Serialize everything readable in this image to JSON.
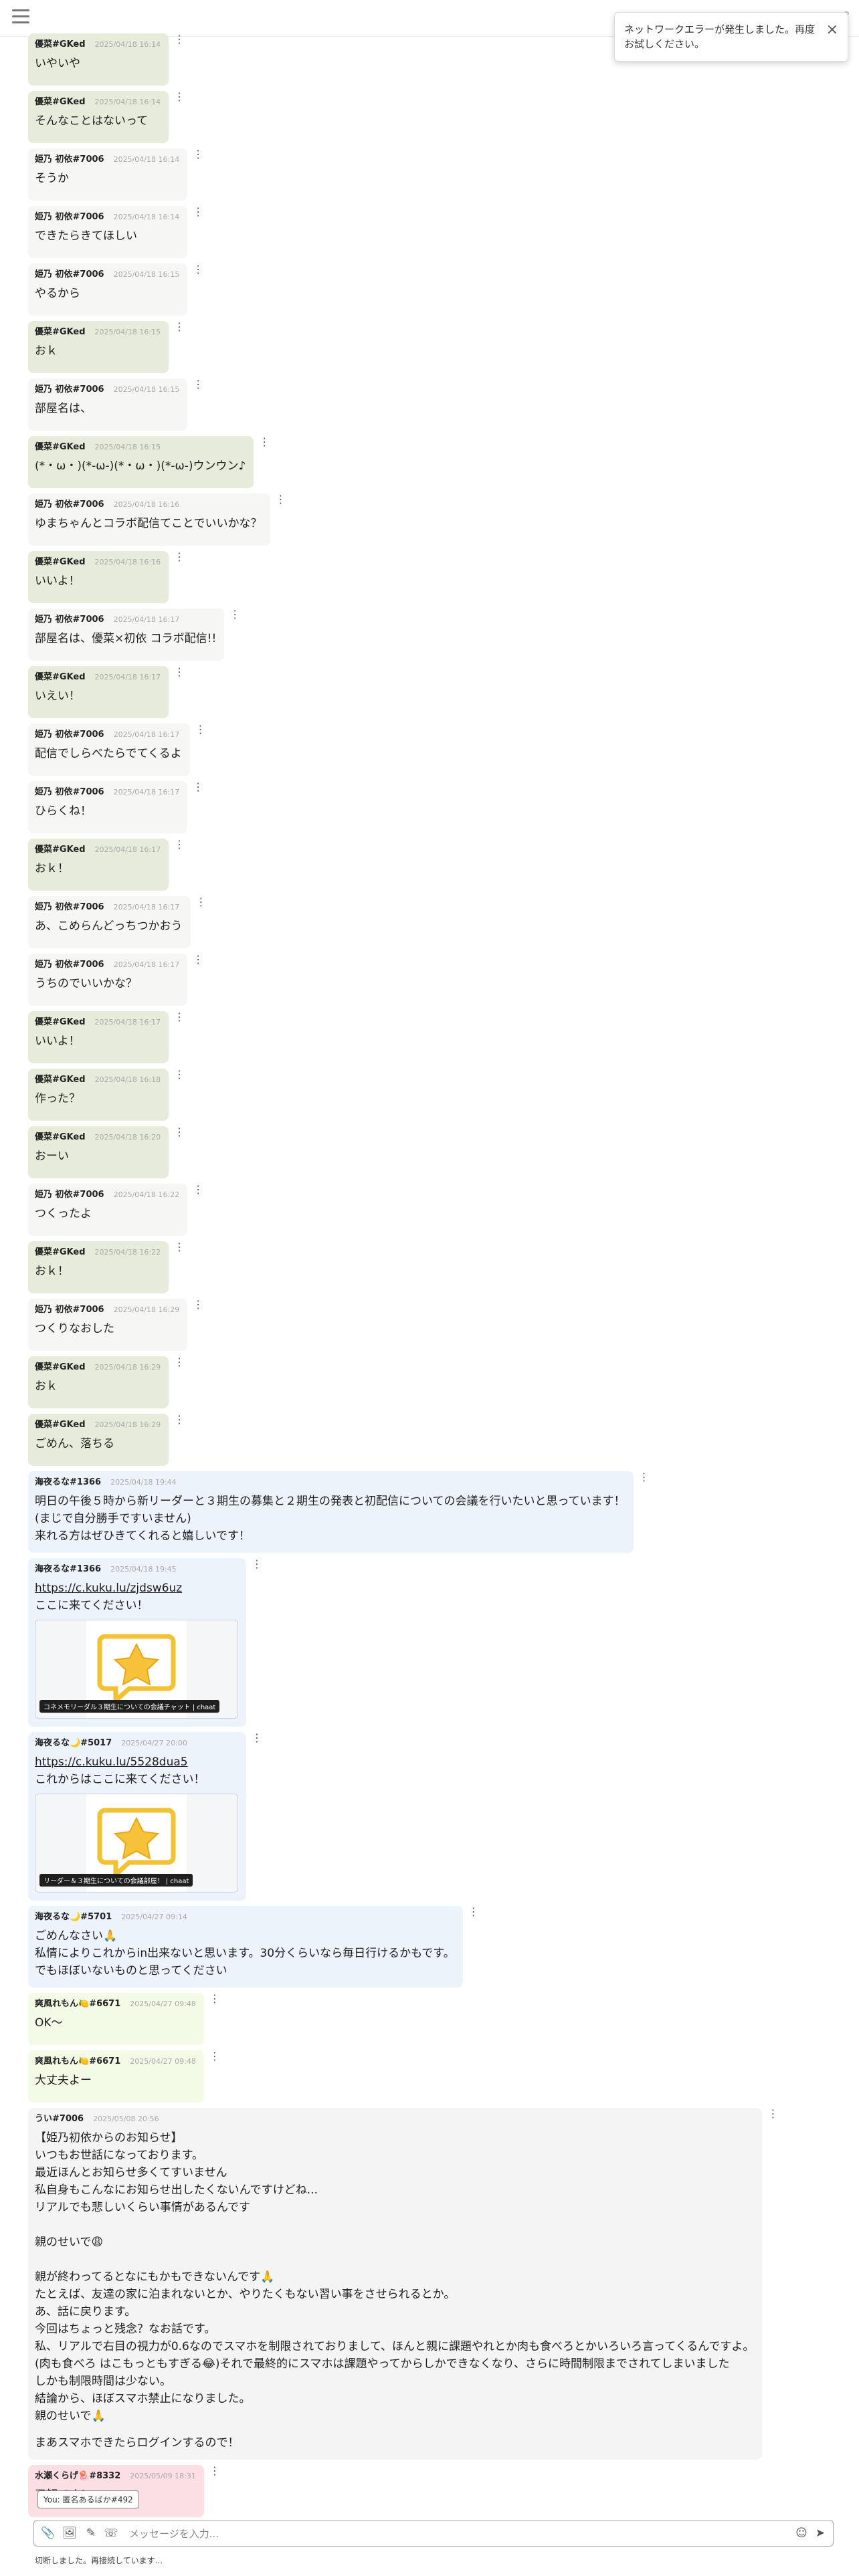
{
  "toast": {
    "message": "ネットワークエラーが発生しました。再度お試しください。",
    "close_icon": "×"
  },
  "messages": [
    {
      "author": "優菜#GKed",
      "time": "2025/04/18 16:14",
      "body": "いやいや",
      "style": "green"
    },
    {
      "author": "優菜#GKed",
      "time": "2025/04/18 16:14",
      "body": "そんなことはないって",
      "style": "green"
    },
    {
      "author": "姫乃 初依#7006",
      "time": "2025/04/18 16:14",
      "body": "そうか",
      "style": "grey"
    },
    {
      "author": "姫乃 初依#7006",
      "time": "2025/04/18 16:14",
      "body": "できたらきてほしい",
      "style": "grey"
    },
    {
      "author": "姫乃 初依#7006",
      "time": "2025/04/18 16:15",
      "body": "やるから",
      "style": "grey"
    },
    {
      "author": "優菜#GKed",
      "time": "2025/04/18 16:15",
      "body": "おｋ",
      "style": "green"
    },
    {
      "author": "姫乃 初依#7006",
      "time": "2025/04/18 16:15",
      "body": "部屋名は、",
      "style": "grey"
    },
    {
      "author": "優菜#GKed",
      "time": "2025/04/18 16:15",
      "body": "(*・ω・)(*-ω-)(*・ω・)(*-ω-)ウンウン♪",
      "style": "green"
    },
    {
      "author": "姫乃 初依#7006",
      "time": "2025/04/18 16:16",
      "body": "ゆまちゃんとコラボ配信てことでいいかな？",
      "style": "grey"
    },
    {
      "author": "優菜#GKed",
      "time": "2025/04/18 16:16",
      "body": "いいよ！",
      "style": "green"
    },
    {
      "author": "姫乃 初依#7006",
      "time": "2025/04/18 16:17",
      "body": "部屋名は、優菜×初依 コラボ配信!!",
      "style": "grey"
    },
    {
      "author": "優菜#GKed",
      "time": "2025/04/18 16:17",
      "body": "いえい！",
      "style": "green"
    },
    {
      "author": "姫乃 初依#7006",
      "time": "2025/04/18 16:17",
      "body": "配信でしらべたらでてくるよ",
      "style": "grey"
    },
    {
      "author": "姫乃 初依#7006",
      "time": "2025/04/18 16:17",
      "body": "ひらくね！",
      "style": "grey"
    },
    {
      "author": "優菜#GKed",
      "time": "2025/04/18 16:17",
      "body": "おｋ！",
      "style": "green"
    },
    {
      "author": "姫乃 初依#7006",
      "time": "2025/04/18 16:17",
      "body": "あ、こめらんどっちつかおう",
      "style": "grey"
    },
    {
      "author": "姫乃 初依#7006",
      "time": "2025/04/18 16:17",
      "body": "うちのでいいかな？",
      "style": "grey"
    },
    {
      "author": "優菜#GKed",
      "time": "2025/04/18 16:17",
      "body": "いいよ！",
      "style": "green"
    },
    {
      "author": "優菜#GKed",
      "time": "2025/04/18 16:18",
      "body": "作った？",
      "style": "green"
    },
    {
      "author": "優菜#GKed",
      "time": "2025/04/18 16:20",
      "body": "おーい",
      "style": "green"
    },
    {
      "author": "姫乃 初依#7006",
      "time": "2025/04/18 16:22",
      "body": "つくったよ",
      "style": "grey"
    },
    {
      "author": "優菜#GKed",
      "time": "2025/04/18 16:22",
      "body": "おｋ！",
      "style": "green"
    },
    {
      "author": "姫乃 初依#7006",
      "time": "2025/04/18 16:29",
      "body": "つくりなおした",
      "style": "grey"
    },
    {
      "author": "優菜#GKed",
      "time": "2025/04/18 16:29",
      "body": "おｋ",
      "style": "green"
    },
    {
      "author": "優菜#GKed",
      "time": "2025/04/18 16:29",
      "body": "ごめん、落ちる",
      "style": "green"
    },
    {
      "author": "海夜るな#1366",
      "time": "2025/04/18 19:44",
      "body": "明日の午後５時から新リーダーと３期生の募集と２期生の発表と初配信についての会議を行いたいと思っています！\n(まじで自分勝手ですいません)\n来れる方はぜひきてくれると嬉しいです！",
      "style": "blue"
    },
    {
      "author": "海夜るな#1366",
      "time": "2025/04/18 19:45",
      "link": "https://c.kuku.lu/zjdsw6uz",
      "body": "ここに来てください！",
      "embed_caption": "コネメモリーダル３期生についての会議チャット | chaat",
      "style": "blue"
    },
    {
      "author": "海夜るな🌙#5017",
      "time": "2025/04/27 20:00",
      "link": "https://c.kuku.lu/5528dua5",
      "body": "これからはここに来てください！",
      "embed_caption": "リーダー＆３期生についての会議部屋！ | chaat",
      "style": "blue"
    },
    {
      "author": "海夜るな🌙#5701",
      "time": "2025/04/27 09:14",
      "body": "ごめんなさい🙏\n私情によりこれからin出来ないと思います。30分くらいなら毎日行けるかもです。\nでもほぼいないものと思ってください",
      "style": "blue"
    },
    {
      "author": "爽風れもん🍋#6671",
      "time": "2025/04/27 09:48",
      "body": "OK～",
      "style": "lime"
    },
    {
      "author": "爽風れもん🍋#6671",
      "time": "2025/04/27 09:48",
      "body": "大丈夫よー",
      "style": "lime"
    },
    {
      "author": "うい#7006",
      "time": "2025/05/08 20:56",
      "body": "【姫乃初依からのお知らせ】\nいつもお世話になっております。\n最近ほんとお知らせ多くてすいません\n私自身もこんなにお知らせ出したくないんですけどね...\nリアルでも悲しいくらい事情があるんです\n\n親のせいで😩\n\n親が終わってるとなにもかもできないんです🙏\nたとえば、友達の家に泊まれないとか、やりたくもない習い事をさせられるとか。\nあ、話に戻ります。\n今回はちょっと残念？なお話です。\n私、リアルで右目の視力が0.6なのでスマホを制限されておりまして、ほんと親に課題やれとか肉も食べろとかいろいろ言ってくるんですよ。\n(肉も食べろ はこもっともすぎる😂)それで最終的にスマホは課題やってからしかできなくなり、さらに時間制限までされてしまいました\nしかも制限時間は少ない。\n結論から、ほぼスマホ禁止になりました。\n親のせいで🙏",
      "fade_text": "まあスマホできたらログインするので！",
      "style": "softgrey"
    },
    {
      "author": "水瀬くらげ🪼#8332",
      "time": "2025/05/09 18:31",
      "body": "了解です！",
      "style": "pink"
    }
  ],
  "composer": {
    "reply_chip": "You: 匿名あるばか#492",
    "placeholder": "メッセージを入力..."
  },
  "status_text": "切断しました。再接続しています..."
}
